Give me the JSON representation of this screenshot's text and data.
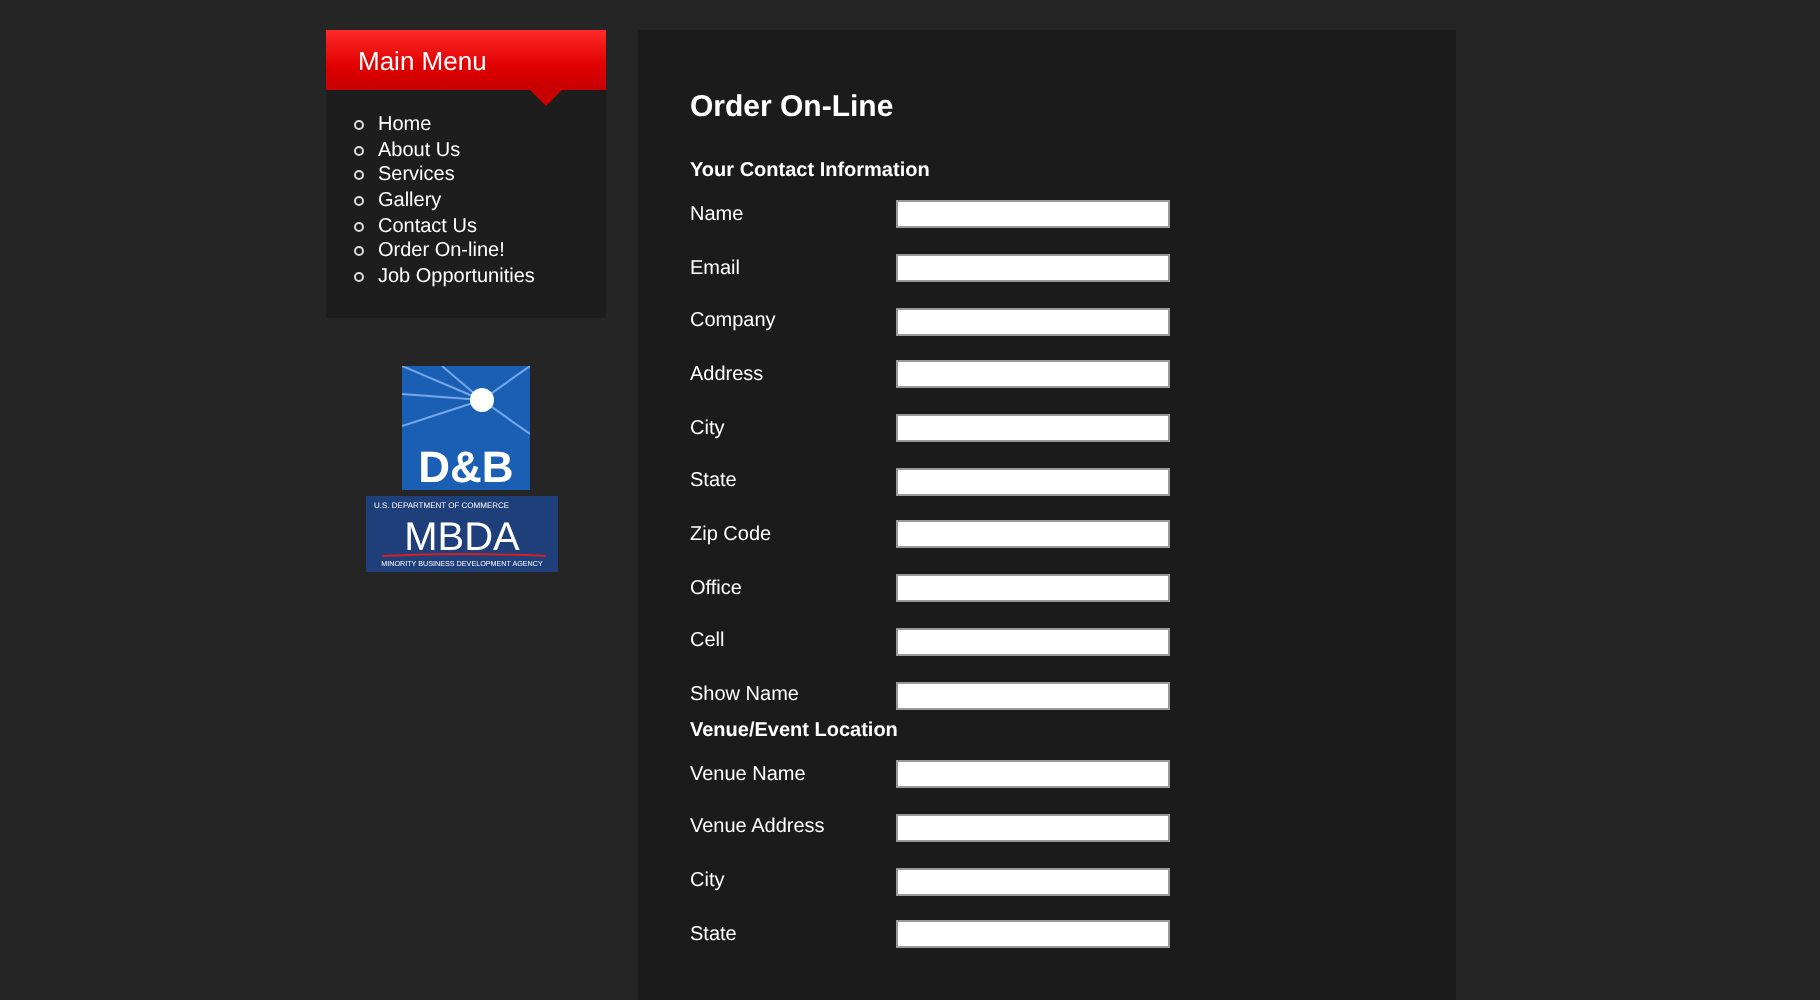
{
  "menu": {
    "title": "Main Menu",
    "items": [
      {
        "label": "Home"
      },
      {
        "label": "About Us"
      },
      {
        "label": "Services"
      },
      {
        "label": "Gallery"
      },
      {
        "label": "Contact Us"
      },
      {
        "label": "Order On-line!"
      },
      {
        "label": "Job Opportunities"
      }
    ]
  },
  "logos": [
    {
      "kind": "dnb",
      "text": "D&B"
    },
    {
      "kind": "mbda",
      "text": "MBDA",
      "top": "U.S. DEPARTMENT OF COMMERCE",
      "bottom": "MINORITY BUSINESS DEVELOPMENT AGENCY"
    }
  ],
  "form": {
    "title": "Order On-Line",
    "sections": [
      {
        "heading": "Your Contact Information",
        "fields": [
          {
            "label": "Name"
          },
          {
            "label": "Email"
          },
          {
            "label": "Company"
          },
          {
            "label": "Address"
          },
          {
            "label": "City"
          },
          {
            "label": "State"
          },
          {
            "label": "Zip Code"
          },
          {
            "label": "Office"
          },
          {
            "label": "Cell"
          },
          {
            "label": "Show Name"
          }
        ]
      },
      {
        "heading": "Venue/Event Location",
        "fields": [
          {
            "label": "Venue Name"
          },
          {
            "label": "Venue Address"
          },
          {
            "label": "City"
          },
          {
            "label": "State"
          }
        ]
      }
    ]
  }
}
